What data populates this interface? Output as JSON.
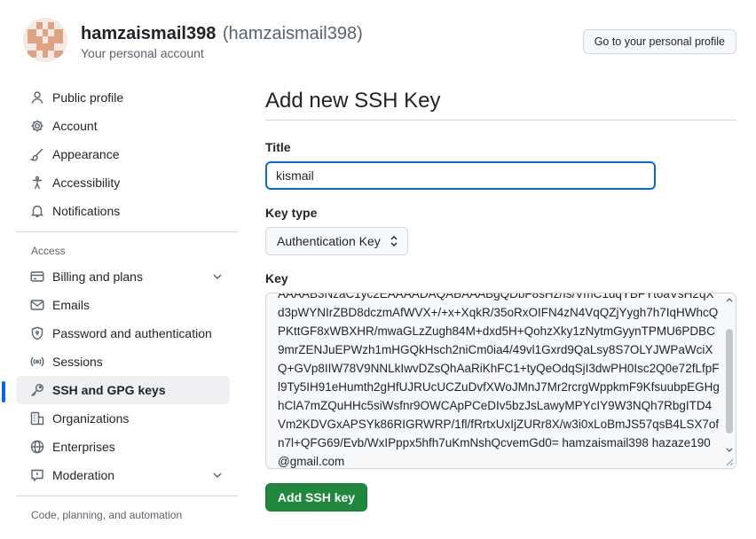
{
  "header": {
    "username": "hamzaismail398",
    "handle": "(hamzaismail398)",
    "subtitle": "Your personal account",
    "profile_button": "Go to your personal profile"
  },
  "sidebar": {
    "items": [
      {
        "label": "Public profile",
        "icon": "person-icon"
      },
      {
        "label": "Account",
        "icon": "gear-icon"
      },
      {
        "label": "Appearance",
        "icon": "paintbrush-icon"
      },
      {
        "label": "Accessibility",
        "icon": "accessibility-icon"
      },
      {
        "label": "Notifications",
        "icon": "bell-icon"
      }
    ],
    "access_label": "Access",
    "access_items": [
      {
        "label": "Billing and plans",
        "icon": "credit-card-icon",
        "expandable": true
      },
      {
        "label": "Emails",
        "icon": "mail-icon"
      },
      {
        "label": "Password and authentication",
        "icon": "shield-lock-icon"
      },
      {
        "label": "Sessions",
        "icon": "broadcast-icon"
      },
      {
        "label": "SSH and GPG keys",
        "icon": "key-icon",
        "active": true
      },
      {
        "label": "Organizations",
        "icon": "organization-icon"
      },
      {
        "label": "Enterprises",
        "icon": "globe-icon"
      },
      {
        "label": "Moderation",
        "icon": "report-icon",
        "expandable": true
      }
    ],
    "code_section_label": "Code, planning, and automation"
  },
  "main": {
    "title": "Add new SSH Key",
    "title_label": "Title",
    "title_value": "kismail",
    "key_type_label": "Key type",
    "key_type_value": "Authentication Key",
    "key_label": "Key",
    "key_value": "AAAAB3NzaC1yc2EAAAADAQABAAABgQDbF8sHz/Is/VmC1uqYBFYt6aVsH2qXd3pWYNIrZBD8dczmAfWVX+/+x+XqkR/35oRxOIFN4zN4VqQZjYygh7h7IqHWhcQPKttGF8xWBXHR/mwaGLzZugh84M+dxd5H+QohzXky1zNytmGyynTPMU6PDBC9mrZENJuEPWzh1mHGQkHsch2niCm0ia4/49vl1Gxrd9QaLsy8S7OLYJWPaWciXQ+GVp8IIW78V9NNLkIwvDZsQhAaRiKhFC1+tyQeOdqSjI3dwPH0Isc2Q0e72fLfpFl9Ty5IH91eHumth2gHfUJRUcUCZuDvfXWoJMnJ7Mr2rcrgWppkmF9KfsuubpEGHghClA7mZQuHHc5siWsfnr9OWCApPCeDIv5bzJsLawyMPYcIY9W3NQh7RbgITD4Vm2KDVGxAPSYk86RIGRWRP/1fl/fRrtxUxIjZURr8X/w3i0xLoBmJS57qsB4LSX7ofn7l+QFG69/Evb/WxIPppx5hfh7uKmNshQcvemGd0= hamzaismail398 hazaze190@gmail.com",
    "submit_label": "Add SSH key"
  }
}
